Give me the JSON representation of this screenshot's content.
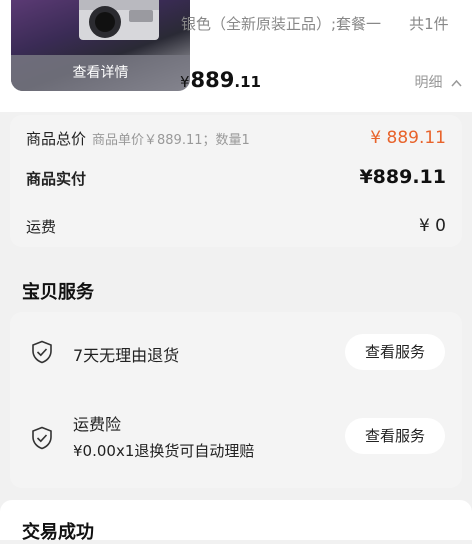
{
  "product": {
    "thumb_overlay": "查看详情",
    "variant": "银色（全新原装正品）;套餐一",
    "quantity_label": "共1件",
    "price_currency": "¥",
    "price_integer": "889",
    "price_decimal": ".11",
    "detail_toggle": "明细",
    "detail_chevron": "^"
  },
  "summary": {
    "total_label": "商品总价",
    "total_sub": "商品单价￥889.11；数量1",
    "total_value": "¥ 889.11",
    "actual_label": "商品实付",
    "actual_value": "¥889.11",
    "shipping_label": "运费",
    "shipping_value": "¥ 0"
  },
  "services": {
    "title": "宝贝服务",
    "items": [
      {
        "title": "7天无理由退货",
        "description": "",
        "button": "查看服务",
        "icon": "shield-check-icon"
      },
      {
        "title": "运费险",
        "description": "¥0.00x1退换货可自动理赔",
        "button": "查看服务",
        "icon": "shield-check-icon"
      }
    ]
  },
  "bottom": {
    "title": "交易成功"
  },
  "colors": {
    "accent_orange": "#e8632b",
    "background": "#f1f1f1",
    "card": "#f4f4f4"
  }
}
